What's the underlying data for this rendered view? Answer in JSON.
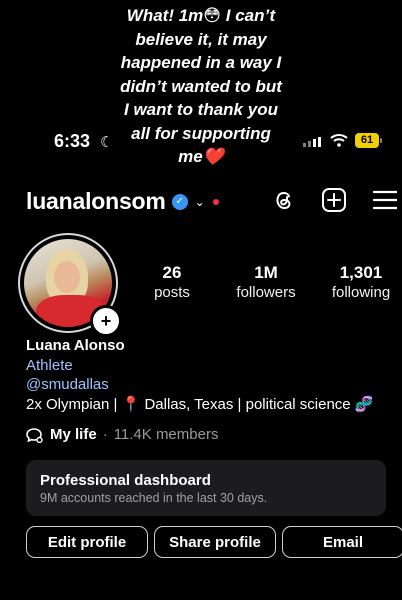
{
  "story_caption": "What! 1m😳 I can’t\nbelieve it, it may\nhappened in a way I\ndidn’t wanted to but\nI want to thank you\nall for supporting\nme❤️",
  "status_bar": {
    "time": "6:33",
    "battery": "61"
  },
  "header": {
    "username": "luanalonsom"
  },
  "stats": [
    {
      "value": "26",
      "label": "posts"
    },
    {
      "value": "1M",
      "label": "followers"
    },
    {
      "value": "1,301",
      "label": "following"
    }
  ],
  "bio": {
    "name": "Luana Alonso",
    "category": "Athlete",
    "mention": "@smudallas",
    "line": "2x Olympian | 📍 Dallas, Texas | political science 🧬"
  },
  "community": {
    "title": "My life",
    "separator": "·",
    "members": "11.4K members"
  },
  "dashboard": {
    "title": "Professional dashboard",
    "subtitle": "9M accounts reached in the last 30 days."
  },
  "buttons": {
    "edit": "Edit profile",
    "share": "Share profile",
    "email": "Email"
  },
  "colors": {
    "verified": "#3897f0",
    "link": "#9ec1ff",
    "battery": "#f2d000",
    "notification_dot": "#ff3040"
  },
  "icons": [
    "moon-icon",
    "signal-icon",
    "wifi-icon",
    "verified-icon",
    "chevron-down-icon",
    "threads-icon",
    "add-post-icon",
    "menu-icon",
    "add-story-icon",
    "community-icon"
  ]
}
